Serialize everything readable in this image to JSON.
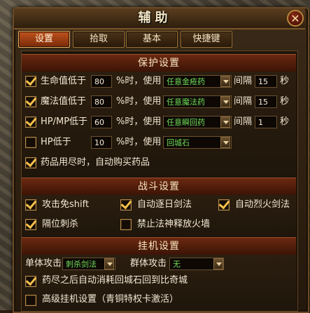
{
  "window": {
    "title": "辅助",
    "close_glyph": "✕"
  },
  "tabs": [
    {
      "label": "设置",
      "active": true
    },
    {
      "label": "拾取",
      "active": false
    },
    {
      "label": "基本",
      "active": false
    },
    {
      "label": "快捷键",
      "active": false
    }
  ],
  "protection": {
    "header": "保护设置",
    "rows": [
      {
        "checked": true,
        "label": "生命值低于",
        "threshold": "80",
        "mid": "%时，使用",
        "item": "任意金疮药",
        "interval_label": "间隔",
        "interval": "15",
        "unit": "秒"
      },
      {
        "checked": true,
        "label": "魔法值低于",
        "threshold": "80",
        "mid": "%时，使用",
        "item": "任意魔法药",
        "interval_label": "间隔",
        "interval": "15",
        "unit": "秒"
      },
      {
        "checked": true,
        "label": "HP/MP低于",
        "threshold": "60",
        "mid": "%时，使用",
        "item": "任意瞬回药",
        "interval_label": "间隔",
        "interval": "1",
        "unit": "秒"
      },
      {
        "checked": false,
        "label": "HP低于",
        "threshold": "10",
        "mid": "%时，使用",
        "item": "回城石"
      }
    ],
    "auto_buy": {
      "checked": true,
      "label": "药品用尽时，自动购买药品"
    }
  },
  "combat": {
    "header": "战斗设置",
    "options": [
      {
        "checked": true,
        "label": "攻击免shift"
      },
      {
        "checked": true,
        "label": "自动逐日剑法"
      },
      {
        "checked": true,
        "label": "自动烈火剑法"
      },
      {
        "checked": true,
        "label": "隔位刺杀"
      },
      {
        "checked": false,
        "label": "禁止法神释放火墙"
      }
    ]
  },
  "idle": {
    "header": "挂机设置",
    "single_label": "单体攻击",
    "single_value": "刺杀剑法",
    "group_label": "群体攻击",
    "group_value": "无",
    "options": [
      {
        "checked": true,
        "label": "药尽之后自动消耗回城石回到比奇城"
      },
      {
        "checked": false,
        "label": "高级挂机设置（青铜特权卡激活）"
      }
    ]
  },
  "colors": {
    "accent": "#c0521c",
    "item_text": "#6fdc5a",
    "check": "#f4c04a"
  }
}
